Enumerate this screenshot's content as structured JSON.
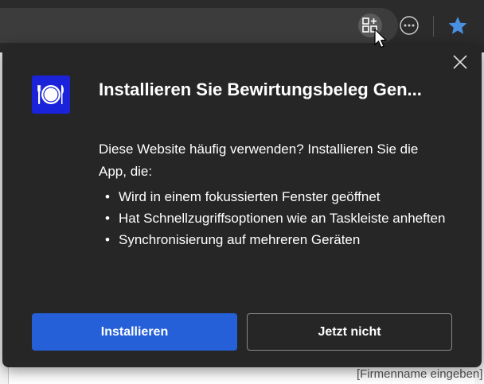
{
  "toolbar": {
    "app_install_icon": "app-install-icon",
    "more_icon": "more-horizontal-icon",
    "favorites_icon": "star-icon"
  },
  "page": {
    "snippet": "[Firmenname eingeben]"
  },
  "popup": {
    "title": "Installieren Sie Bewirtungsbeleg Gen...",
    "description": "Diese Website häufig verwenden? Installieren Sie die App, die:",
    "features": [
      "Wird in einem fokussierten Fenster geöffnet",
      "Hat Schnellzugriffsoptionen wie an Taskleiste anheften",
      "Synchronisierung auf mehreren Geräten"
    ],
    "install_label": "Installieren",
    "not_now_label": "Jetzt nicht",
    "app_icon": "plate-cutlery-icon",
    "close_icon": "close-icon"
  },
  "colors": {
    "popup_bg": "#262626",
    "primary_button": "#2560d8",
    "app_icon_bg": "#1a23d9",
    "favorite_star": "#4a90e2"
  }
}
